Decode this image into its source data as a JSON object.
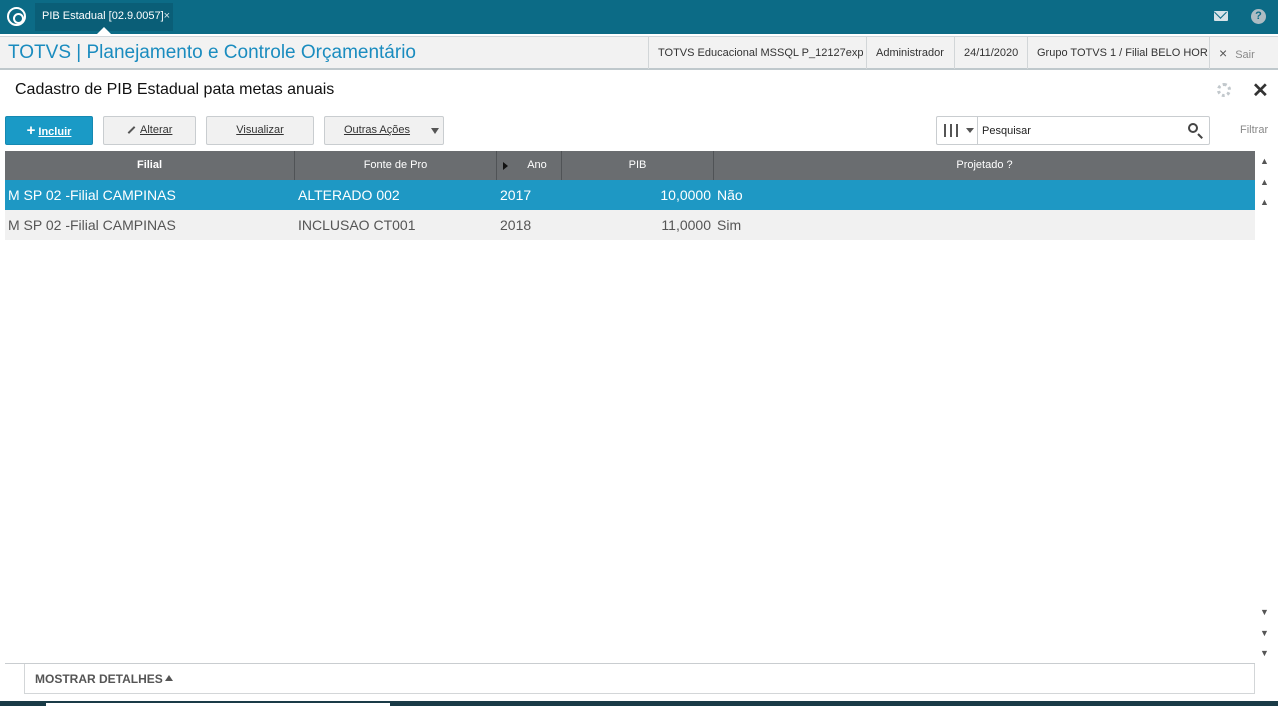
{
  "window": {
    "tab_label": "PIB Estadual [02.9.0057]",
    "tab_close": "×"
  },
  "header": {
    "app_title": "TOTVS | Planejamento e Controle Orçamentário",
    "environment": "TOTVS Educacional MSSQL P_12127exp",
    "user": "Administrador",
    "date": "24/11/2020",
    "branch": "Grupo TOTVS 1 / Filial BELO HOR",
    "exit_label": "Sair",
    "exit_icon": "×"
  },
  "page": {
    "title": "Cadastro de PIB Estadual pata metas anuais",
    "close_icon": "✕"
  },
  "toolbar": {
    "include_label": "Incluir",
    "include_icon": "+",
    "alter_label": "Alterar",
    "view_label": "Visualizar",
    "more_label": "Outras Ações",
    "search_placeholder": "Pesquisar",
    "filter_label": "Filtrar"
  },
  "grid": {
    "columns": [
      "Filial",
      "Fonte de Pro",
      "Ano",
      "PIB",
      "Projetado ?"
    ],
    "rows": [
      {
        "filial": "M SP 02 -Filial CAMPINAS",
        "fonte": "ALTERADO 002",
        "ano": "2017",
        "pib": "10,0000",
        "projetado": "Não"
      },
      {
        "filial": "M SP 02 -Filial CAMPINAS",
        "fonte": "INCLUSAO CT001",
        "ano": "2018",
        "pib": "11,0000",
        "projetado": "Sim"
      }
    ],
    "selected_row": 0
  },
  "details": {
    "label": "MOSTRAR DETALHES"
  },
  "colors": {
    "topbar": "#0c6b86",
    "accent": "#1a9ac6",
    "selected_row": "#1e98c4",
    "grid_header": "#6a6d70"
  }
}
